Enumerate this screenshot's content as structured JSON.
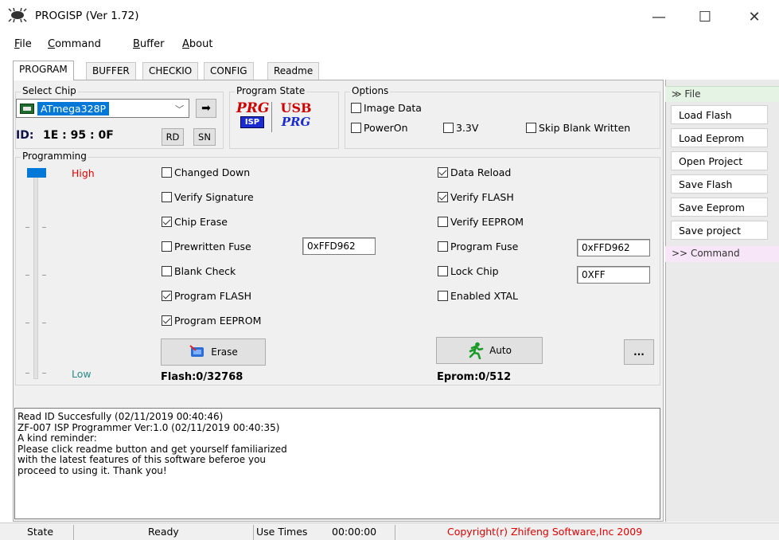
{
  "window": {
    "title": "PROGISP (Ver 1.72)",
    "minimize": "—",
    "maximize": "☐",
    "close": "✕"
  },
  "menu": [
    {
      "accel": "F",
      "rest": "ile"
    },
    {
      "accel": "C",
      "rest": "ommand"
    },
    {
      "accel": "B",
      "rest": "uffer"
    },
    {
      "accel": "A",
      "rest": "bout"
    }
  ],
  "tabs": [
    "PROGRAM",
    "BUFFER",
    "CHECKIO",
    "CONFIG",
    "Readme"
  ],
  "select_chip": {
    "label": "Select Chip",
    "selected": "ATmega328P",
    "arrow_btn": "➡",
    "id_label": "ID:",
    "id_value": "1E : 95 : 0F",
    "rd": "RD",
    "sn": "SN"
  },
  "program_state": {
    "label": "Program State",
    "prg1": "PRG",
    "isp": "ISP",
    "usb": "USB",
    "prg2": "PRG"
  },
  "options": {
    "label": "Options",
    "image_data": "Image Data",
    "power_on": "PowerOn",
    "v33": "3.3V",
    "skip_blank": "Skip Blank Written"
  },
  "programming": {
    "label": "Programming",
    "high": "High",
    "low": "Low",
    "left_checks": [
      {
        "label": "Changed Down",
        "checked": false
      },
      {
        "label": "Verify Signature",
        "checked": false
      },
      {
        "label": "Chip Erase",
        "checked": true
      },
      {
        "label": "Prewritten Fuse",
        "checked": false
      },
      {
        "label": "Blank Check",
        "checked": false
      },
      {
        "label": "Program FLASH",
        "checked": true
      },
      {
        "label": "Program EEPROM",
        "checked": true
      }
    ],
    "right_checks": [
      {
        "label": "Data Reload",
        "checked": true
      },
      {
        "label": "Verify FLASH",
        "checked": true
      },
      {
        "label": "Verify EEPROM",
        "checked": false
      },
      {
        "label": "Program Fuse",
        "checked": false
      },
      {
        "label": "Lock Chip",
        "checked": false
      },
      {
        "label": "Enabled XTAL",
        "checked": false
      }
    ],
    "prewritten_fuse_value": "0xFFD962",
    "program_fuse_value": "0xFFD962",
    "lock_value": "0XFF",
    "erase_btn": "Erase",
    "auto_btn": "Auto",
    "more_btn": "...",
    "flash_status": "Flash:0/32768",
    "eprom_status": "Eprom:0/512"
  },
  "log": [
    "Read ID Succesfully (02/11/2019 00:40:46)",
    "ZF-007 ISP Programmer Ver:1.0 (02/11/2019 00:40:35)",
    "A kind reminder:",
    "Please click readme button and get yourself familiarized",
    "with the latest features of this software beferoe you",
    "proceed to using it. Thank you!"
  ],
  "side": {
    "file_header": "File",
    "buttons": [
      "Load Flash",
      "Load Eeprom",
      "Open Project",
      "Save Flash",
      "Save Eeprom",
      "Save project"
    ],
    "command_header": "Command"
  },
  "statusbar": {
    "state_label": "State",
    "state_value": "Ready",
    "use_times_label": "Use Times",
    "use_times_value": "00:00:00",
    "copyright": "Copyright(r) Zhifeng Software,Inc 2009"
  },
  "colors": {
    "accent": "#0078d7",
    "high_red": "#e00000",
    "low_teal": "#2a8a8a",
    "copyright_red": "#e00000"
  }
}
